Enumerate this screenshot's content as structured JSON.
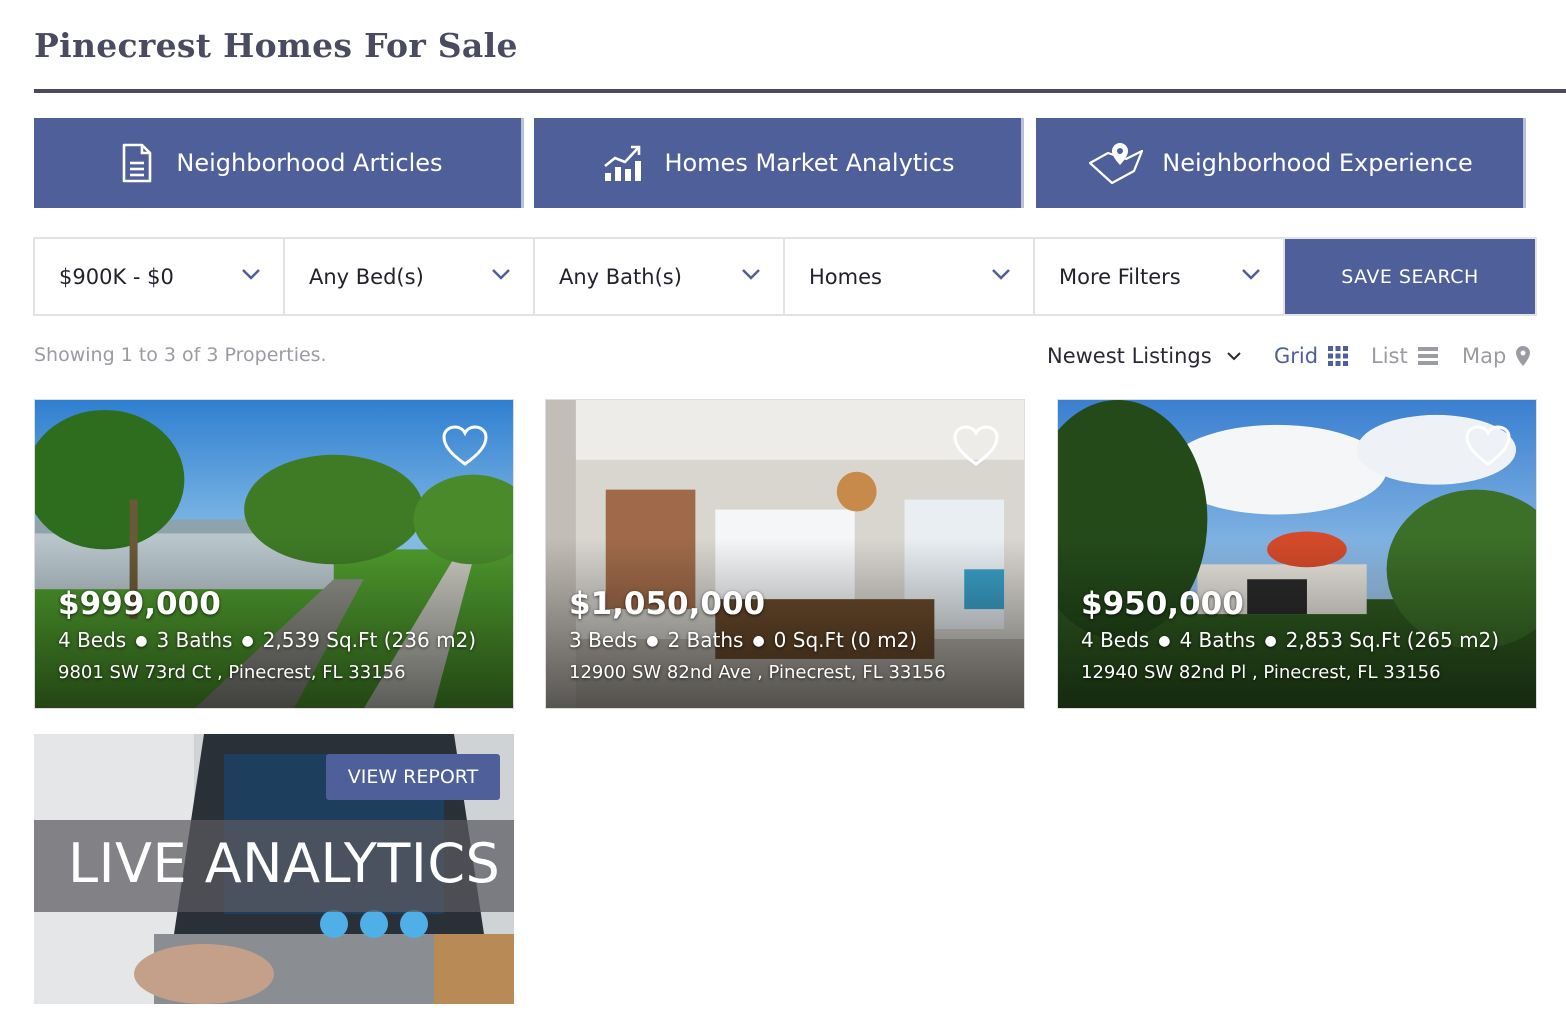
{
  "page": {
    "title": "Pinecrest Homes For Sale"
  },
  "nav_buttons": [
    {
      "label": "Neighborhood Articles",
      "icon": "document-icon"
    },
    {
      "label": "Homes Market Analytics",
      "icon": "bar-chart-icon"
    },
    {
      "label": "Neighborhood Experience",
      "icon": "map-pin-icon"
    }
  ],
  "filters": {
    "price": "$900K - $0",
    "beds": "Any Bed(s)",
    "baths": "Any Bath(s)",
    "type": "Homes",
    "more": "More Filters",
    "save_search": "SAVE SEARCH"
  },
  "results": {
    "showing": "Showing 1 to 3 of 3 Properties.",
    "sort": "Newest Listings",
    "views": {
      "grid": "Grid",
      "list": "List",
      "map": "Map"
    },
    "active_view": "grid"
  },
  "listings": [
    {
      "price": "$999,000",
      "beds": "4 Beds",
      "baths": "3 Baths",
      "size": "2,539 Sq.Ft (236 m2)",
      "address": "9801 SW 73rd Ct ,  Pinecrest, FL 33156"
    },
    {
      "price": "$1,050,000",
      "beds": "3 Beds",
      "baths": "2 Baths",
      "size": "0 Sq.Ft (0 m2)",
      "address": "12900 SW 82nd Ave ,  Pinecrest, FL 33156"
    },
    {
      "price": "$950,000",
      "beds": "4 Beds",
      "baths": "4 Baths",
      "size": "2,853 Sq.Ft (265 m2)",
      "address": "12940 SW 82nd Pl ,  Pinecrest, FL 33156"
    }
  ],
  "analytics_card": {
    "title": "LIVE ANALYTICS",
    "button": "VIEW REPORT"
  },
  "colors": {
    "brand": "#4f5f99",
    "title": "#4a4a60",
    "muted": "#9b9ba3"
  }
}
